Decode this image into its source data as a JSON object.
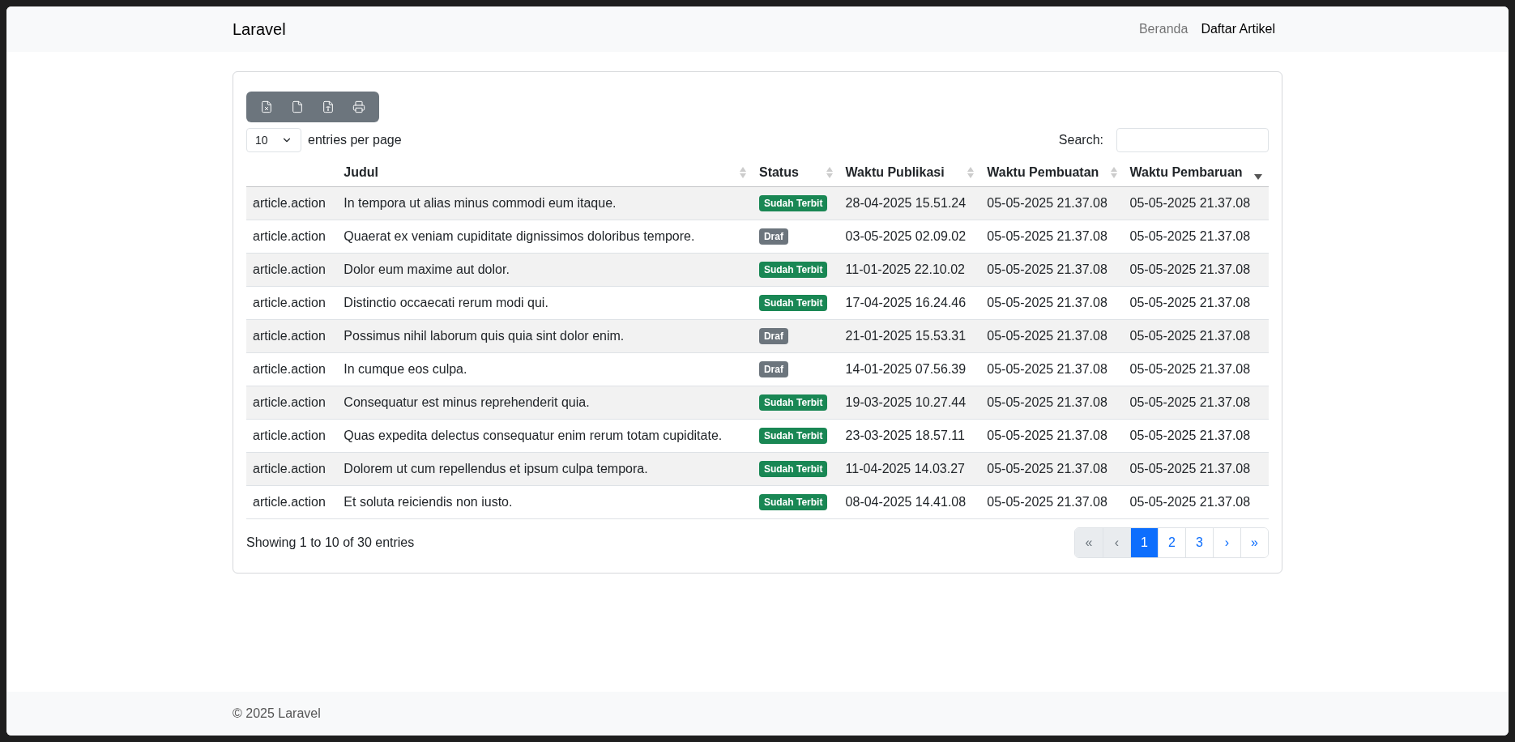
{
  "navbar": {
    "brand": "Laravel",
    "links": [
      {
        "label": "Beranda",
        "selected": false
      },
      {
        "label": "Daftar Artikel",
        "selected": true
      }
    ]
  },
  "toolbar": {
    "buttons": [
      {
        "kind": "excel"
      },
      {
        "kind": "csv"
      },
      {
        "kind": "pdf"
      },
      {
        "kind": "print"
      }
    ]
  },
  "page_size": {
    "value": "10",
    "label": "entries per page"
  },
  "search": {
    "label": "Search:"
  },
  "table": {
    "columns": [
      {
        "label": "Judul",
        "sorted_desc": false
      },
      {
        "label": "Status",
        "sorted_desc": false
      },
      {
        "label": "Waktu Publikasi",
        "sorted_desc": false
      },
      {
        "label": "Waktu Pembuatan",
        "sorted_desc": false
      },
      {
        "label": "Waktu Pembaruan",
        "sorted_desc": true
      }
    ],
    "rows": [
      {
        "action": "article.action",
        "title": "In tempora ut alias minus commodi eum itaque.",
        "status": {
          "label": "Sudah Terbit",
          "color": "#198754"
        },
        "published": "28-04-2025 15.51.24",
        "created": "05-05-2025 21.37.08",
        "updated": "05-05-2025 21.37.08"
      },
      {
        "action": "article.action",
        "title": "Quaerat ex veniam cupiditate dignissimos doloribus tempore.",
        "status": {
          "label": "Draf",
          "color": "#6c757d"
        },
        "published": "03-05-2025 02.09.02",
        "created": "05-05-2025 21.37.08",
        "updated": "05-05-2025 21.37.08"
      },
      {
        "action": "article.action",
        "title": "Dolor eum maxime aut dolor.",
        "status": {
          "label": "Sudah Terbit",
          "color": "#198754"
        },
        "published": "11-01-2025 22.10.02",
        "created": "05-05-2025 21.37.08",
        "updated": "05-05-2025 21.37.08"
      },
      {
        "action": "article.action",
        "title": "Distinctio occaecati rerum modi qui.",
        "status": {
          "label": "Sudah Terbit",
          "color": "#198754"
        },
        "published": "17-04-2025 16.24.46",
        "created": "05-05-2025 21.37.08",
        "updated": "05-05-2025 21.37.08"
      },
      {
        "action": "article.action",
        "title": "Possimus nihil laborum quis quia sint dolor enim.",
        "status": {
          "label": "Draf",
          "color": "#6c757d"
        },
        "published": "21-01-2025 15.53.31",
        "created": "05-05-2025 21.37.08",
        "updated": "05-05-2025 21.37.08"
      },
      {
        "action": "article.action",
        "title": "In cumque eos culpa.",
        "status": {
          "label": "Draf",
          "color": "#6c757d"
        },
        "published": "14-01-2025 07.56.39",
        "created": "05-05-2025 21.37.08",
        "updated": "05-05-2025 21.37.08"
      },
      {
        "action": "article.action",
        "title": "Consequatur est minus reprehenderit quia.",
        "status": {
          "label": "Sudah Terbit",
          "color": "#198754"
        },
        "published": "19-03-2025 10.27.44",
        "created": "05-05-2025 21.37.08",
        "updated": "05-05-2025 21.37.08"
      },
      {
        "action": "article.action",
        "title": "Quas expedita delectus consequatur enim rerum totam cupiditate.",
        "status": {
          "label": "Sudah Terbit",
          "color": "#198754"
        },
        "published": "23-03-2025 18.57.11",
        "created": "05-05-2025 21.37.08",
        "updated": "05-05-2025 21.37.08"
      },
      {
        "action": "article.action",
        "title": "Dolorem ut cum repellendus et ipsum culpa tempora.",
        "status": {
          "label": "Sudah Terbit",
          "color": "#198754"
        },
        "published": "11-04-2025 14.03.27",
        "created": "05-05-2025 21.37.08",
        "updated": "05-05-2025 21.37.08"
      },
      {
        "action": "article.action",
        "title": "Et soluta reiciendis non iusto.",
        "status": {
          "label": "Sudah Terbit",
          "color": "#198754"
        },
        "published": "08-04-2025 14.41.08",
        "created": "05-05-2025 21.37.08",
        "updated": "05-05-2025 21.37.08"
      }
    ]
  },
  "info": "Showing 1 to 10 of 30 entries",
  "pagination": [
    {
      "label": "«",
      "selected": false,
      "disabled": true
    },
    {
      "label": "‹",
      "selected": false,
      "disabled": true
    },
    {
      "label": "1",
      "selected": true,
      "disabled": false
    },
    {
      "label": "2",
      "selected": false,
      "disabled": false
    },
    {
      "label": "3",
      "selected": false,
      "disabled": false
    },
    {
      "label": "›",
      "selected": false,
      "disabled": false
    },
    {
      "label": "»",
      "selected": false,
      "disabled": false
    }
  ],
  "footer": "© 2025 Laravel"
}
